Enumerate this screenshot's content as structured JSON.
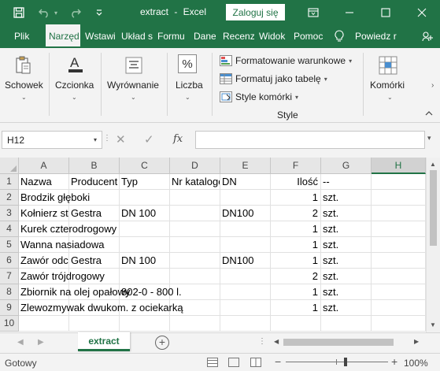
{
  "titlebar": {
    "file_name": "extract",
    "separator": "-",
    "app_name": "Excel",
    "login_label": "Zaloguj się",
    "save_icon": "save-icon",
    "undo_icon": "undo-icon",
    "redo_icon": "redo-icon",
    "qat_icon": "customize-quick-access-icon"
  },
  "tabs": [
    {
      "label": "Plik"
    },
    {
      "label": "Narzędzia główne",
      "active": true
    },
    {
      "label": "Wstawianie"
    },
    {
      "label": "Układ strony"
    },
    {
      "label": "Formuły"
    },
    {
      "label": "Dane"
    },
    {
      "label": "Recenzja"
    },
    {
      "label": "Widok"
    },
    {
      "label": "Pomoc"
    },
    {
      "label": "Powiedz mi"
    }
  ],
  "tabs_display": [
    "Plik",
    "Narzęd",
    "Wstawi",
    "Układ s",
    "Formu",
    "Dane",
    "Recenz",
    "Widok",
    "Pomoc",
    "Powiedz r"
  ],
  "ribbon": {
    "clipboard_label": "Schowek",
    "font_label": "Czcionka",
    "alignment_label": "Wyrównanie",
    "number_label": "Liczba",
    "number_symbol": "%",
    "cond_format_label": "Formatowanie warunkowe",
    "format_table_label": "Formatuj jako tabelę",
    "cell_styles_label": "Style komórki",
    "styles_group_label": "Style",
    "cells_label": "Komórki"
  },
  "formula_bar": {
    "name_box": "H12",
    "cancel_symbol": "✕",
    "enter_symbol": "✓",
    "fx_label": "fx",
    "formula_value": ""
  },
  "columns": [
    "A",
    "B",
    "C",
    "D",
    "E",
    "F",
    "G",
    "H"
  ],
  "selected_column": "H",
  "header_row": [
    "Nazwa",
    "Producent",
    "Typ",
    "Nr katalogowy",
    "DN",
    "Ilość",
    "--"
  ],
  "rows": [
    {
      "num": "1",
      "cells": [
        "Nazwa",
        "Producent",
        "Typ",
        "Nr katalogowy",
        "DN",
        "Ilość",
        "--"
      ]
    },
    {
      "num": "2",
      "cells": [
        "Brodzik głęboki",
        "",
        "",
        "",
        "",
        "1",
        "szt."
      ]
    },
    {
      "num": "3",
      "cells": [
        "Kołnierz stalowy",
        "Gestra",
        "DN 100",
        "",
        "DN100",
        "2",
        "szt."
      ]
    },
    {
      "num": "4",
      "cells": [
        "Kurek czterodrogowy",
        "",
        "",
        "",
        "",
        "1",
        "szt."
      ]
    },
    {
      "num": "5",
      "cells": [
        "Wanna nasiadowa",
        "",
        "",
        "",
        "",
        "1",
        "szt."
      ]
    },
    {
      "num": "6",
      "cells": [
        "Zawór odcinający",
        "Gestra",
        "DN 100",
        "",
        "DN100",
        "1",
        "szt."
      ]
    },
    {
      "num": "7",
      "cells": [
        "Zawór trójdrogowy",
        "",
        "",
        "",
        "",
        "2",
        "szt."
      ]
    },
    {
      "num": "8",
      "cells": [
        "Zbiornik na olej opałowy",
        "",
        "802-0 - 800 l.",
        "",
        "",
        "1",
        "szt."
      ]
    },
    {
      "num": "9",
      "cells": [
        "Zlewozmywak dwukom. z ociekarką",
        "",
        "",
        "",
        "",
        "1",
        "szt."
      ]
    },
    {
      "num": "10",
      "cells": [
        "",
        "",
        "",
        "",
        "",
        "",
        ""
      ]
    }
  ],
  "sheet": {
    "active_tab": "extract",
    "add_symbol": "+"
  },
  "status": {
    "text": "Gotowy",
    "zoom_minus": "−",
    "zoom_plus": "+",
    "zoom_level": "100%"
  },
  "colors": {
    "accent": "#217346",
    "ribbon_bg": "#f3f3f3",
    "grid_line": "#e1e1e1"
  }
}
